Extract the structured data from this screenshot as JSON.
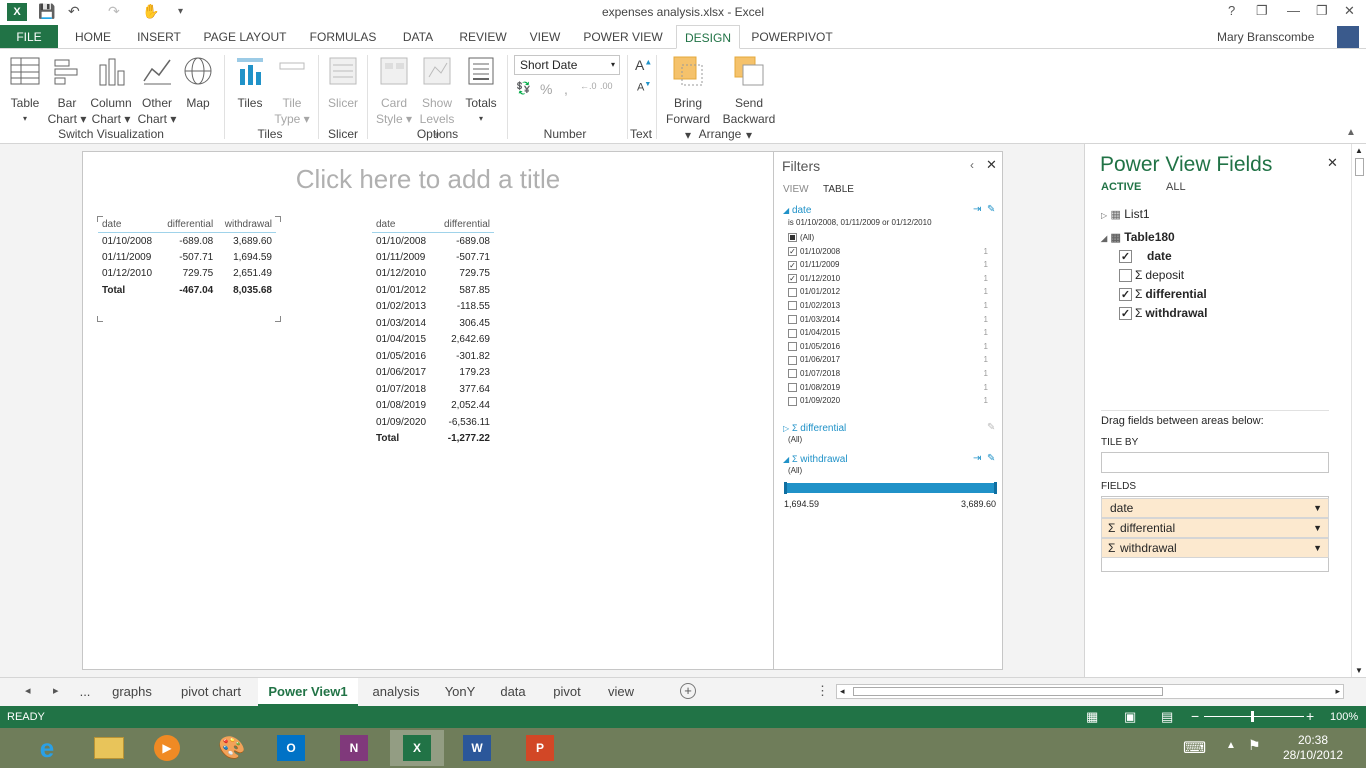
{
  "window": {
    "title": "expenses analysis.xlsx - Excel",
    "user": "Mary Branscombe"
  },
  "tabs": [
    "FILE",
    "HOME",
    "INSERT",
    "PAGE LAYOUT",
    "FORMULAS",
    "DATA",
    "REVIEW",
    "VIEW",
    "POWER VIEW",
    "DESIGN",
    "POWERPIVOT"
  ],
  "ribbon": {
    "table": "Table",
    "bar_chart": [
      "Bar",
      "Chart"
    ],
    "column_chart": [
      "Column",
      "Chart"
    ],
    "other_chart": [
      "Other",
      "Chart"
    ],
    "map": "Map",
    "tiles": "Tiles",
    "tile_type": [
      "Tile",
      "Type"
    ],
    "slicer": "Slicer",
    "card_style": [
      "Card",
      "Style"
    ],
    "show_levels": [
      "Show",
      "Levels"
    ],
    "totals": "Totals",
    "number_format": "Short Date",
    "bring_forward": [
      "Bring",
      "Forward"
    ],
    "send_backward": [
      "Send",
      "Backward"
    ],
    "groups": {
      "switch_viz": "Switch Visualization",
      "tiles": "Tiles",
      "slicer": "Slicer",
      "options": "Options",
      "number": "Number",
      "text": "Text",
      "arrange": "Arrange"
    }
  },
  "canvas": {
    "title_placeholder": "Click here to add a title",
    "table1": {
      "headers": [
        "date",
        "differential",
        "withdrawal"
      ],
      "rows": [
        [
          "01/10/2008",
          "-689.08",
          "3,689.60"
        ],
        [
          "01/11/2009",
          "-507.71",
          "1,694.59"
        ],
        [
          "01/12/2010",
          "729.75",
          "2,651.49"
        ]
      ],
      "total": [
        "Total",
        "-467.04",
        "8,035.68"
      ]
    },
    "table2": {
      "headers": [
        "date",
        "differential"
      ],
      "rows": [
        [
          "01/10/2008",
          "-689.08"
        ],
        [
          "01/11/2009",
          "-507.71"
        ],
        [
          "01/12/2010",
          "729.75"
        ],
        [
          "01/01/2012",
          "587.85"
        ],
        [
          "01/02/2013",
          "-118.55"
        ],
        [
          "01/03/2014",
          "306.45"
        ],
        [
          "01/04/2015",
          "2,642.69"
        ],
        [
          "01/05/2016",
          "-301.82"
        ],
        [
          "01/06/2017",
          "179.23"
        ],
        [
          "01/07/2018",
          "377.64"
        ],
        [
          "01/08/2019",
          "2,052.44"
        ],
        [
          "01/09/2020",
          "-6,536.11"
        ]
      ],
      "total": [
        "Total",
        "-1,277.22"
      ]
    }
  },
  "filters": {
    "title": "Filters",
    "view": "VIEW",
    "table": "TABLE",
    "date_field": "date",
    "date_desc": "is 01/10/2008, 01/11/2009 or 01/12/2010",
    "date_items": [
      {
        "label": "(All)",
        "state": "partial",
        "count": ""
      },
      {
        "label": "01/10/2008",
        "state": "checked",
        "count": "1"
      },
      {
        "label": "01/11/2009",
        "state": "checked",
        "count": "1"
      },
      {
        "label": "01/12/2010",
        "state": "checked",
        "count": "1"
      },
      {
        "label": "01/01/2012",
        "state": "",
        "count": "1"
      },
      {
        "label": "01/02/2013",
        "state": "",
        "count": "1"
      },
      {
        "label": "01/03/2014",
        "state": "",
        "count": "1"
      },
      {
        "label": "01/04/2015",
        "state": "",
        "count": "1"
      },
      {
        "label": "01/05/2016",
        "state": "",
        "count": "1"
      },
      {
        "label": "01/06/2017",
        "state": "",
        "count": "1"
      },
      {
        "label": "01/07/2018",
        "state": "",
        "count": "1"
      },
      {
        "label": "01/08/2019",
        "state": "",
        "count": "1"
      },
      {
        "label": "01/09/2020",
        "state": "",
        "count": "1"
      }
    ],
    "differential_field": "differential",
    "differential_desc": "(All)",
    "withdrawal_field": "withdrawal",
    "withdrawal_desc": "(All)",
    "range_min": "1,694.59",
    "range_max": "3,689.60"
  },
  "fields_pane": {
    "title": "Power View Fields",
    "active": "ACTIVE",
    "all": "ALL",
    "list1": "List1",
    "table180": "Table180",
    "fields": [
      {
        "name": "date",
        "checked": true,
        "sigma": false
      },
      {
        "name": "deposit",
        "checked": false,
        "sigma": true
      },
      {
        "name": "differential",
        "checked": true,
        "sigma": true
      },
      {
        "name": "withdrawal",
        "checked": true,
        "sigma": true
      }
    ],
    "drag_hint": "Drag fields between areas below:",
    "tile_by": "TILE BY",
    "fields_label": "FIELDS",
    "field_wells": [
      "date",
      "differential",
      "withdrawal"
    ]
  },
  "sheets": [
    "...",
    "graphs",
    "pivot chart",
    "Power View1",
    "analysis",
    "YonY",
    "data",
    "pivot",
    "view"
  ],
  "active_sheet": "Power View1",
  "status": {
    "ready": "READY",
    "zoom": "100%"
  },
  "taskbar": {
    "time": "20:38",
    "date": "28/10/2012"
  },
  "colors": {
    "excel_green": "#217346",
    "accent_blue": "#2092c8",
    "field_well": "#fce9cf"
  }
}
